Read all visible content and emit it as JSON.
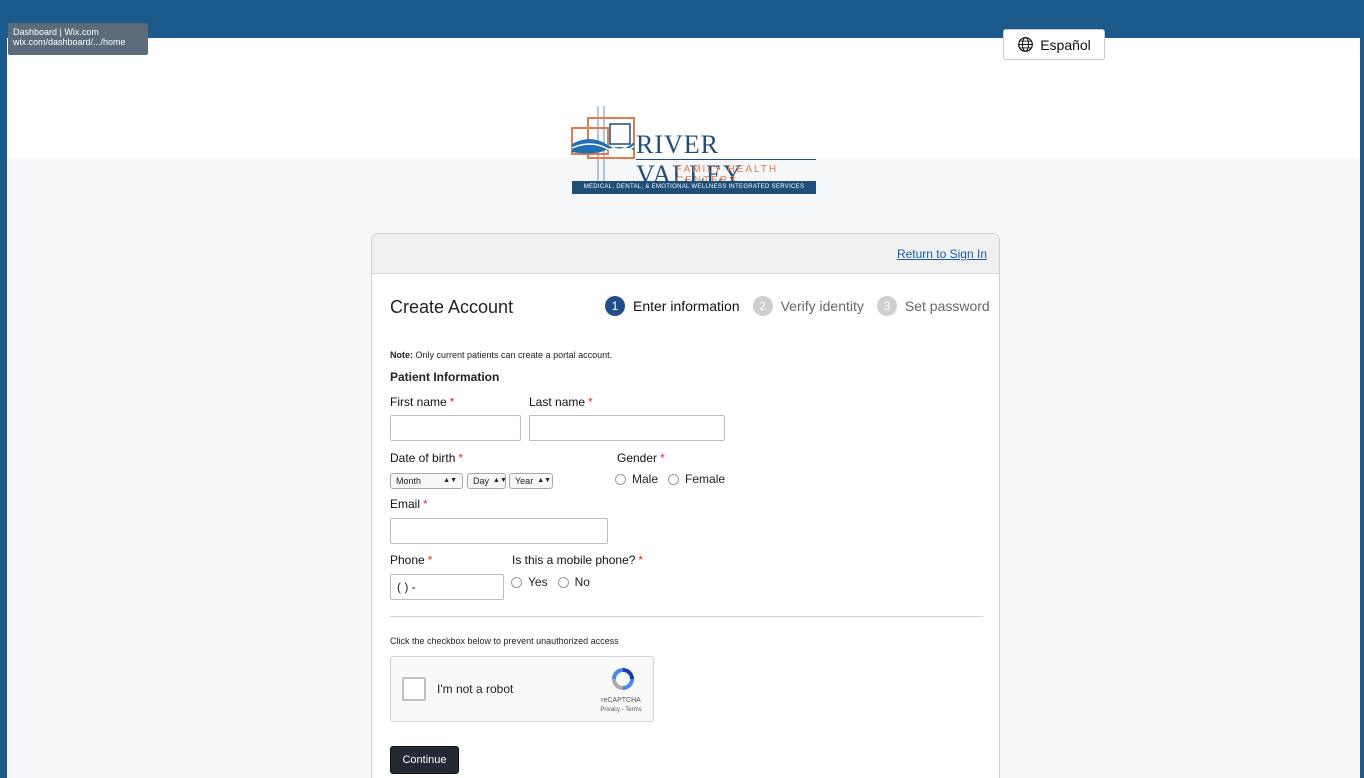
{
  "browser": {
    "tooltip_title": "Dashboard | Wix.com",
    "tooltip_url": "wix.com/dashboard/.../home"
  },
  "language_button": {
    "label": "Español",
    "icon": "globe-icon"
  },
  "logo": {
    "title": "RIVER VALLEY",
    "subtitle": "FAMILY HEALTH CENTERS",
    "band": "MEDICAL, DENTAL, & EMOTIONAL WELLNESS INTEGRATED SERVICES"
  },
  "card": {
    "return_link": "Return to Sign In",
    "title": "Create Account",
    "steps": [
      {
        "num": "1",
        "label": "Enter information"
      },
      {
        "num": "2",
        "label": "Verify identity"
      },
      {
        "num": "3",
        "label": "Set password"
      }
    ]
  },
  "form": {
    "note_bold": "Note:",
    "note_text": " Only current patients can create a portal account.",
    "section_title": "Patient Information",
    "required_mark": "*",
    "first_name_label": "First name",
    "last_name_label": "Last name",
    "dob_label": "Date of birth",
    "month": "Month",
    "day": "Day",
    "year": "Year",
    "gender_label": "Gender",
    "male": "Male",
    "female": "Female",
    "email_label": "Email",
    "phone_label": "Phone",
    "phone_value": "(  )  -",
    "mobile_label": "Is this a mobile phone?",
    "yes": "Yes",
    "no": "No"
  },
  "captcha": {
    "note": "Click the checkbox below to prevent unauthorized access",
    "label": "I'm not a robot",
    "brand": "reCAPTCHA",
    "links": "Privacy - Terms"
  },
  "continue_label": "Continue",
  "colors": {
    "frame": "#1d5a8c",
    "accent": "#1f4e8a",
    "required": "#d9342b",
    "button": "#232a33"
  }
}
